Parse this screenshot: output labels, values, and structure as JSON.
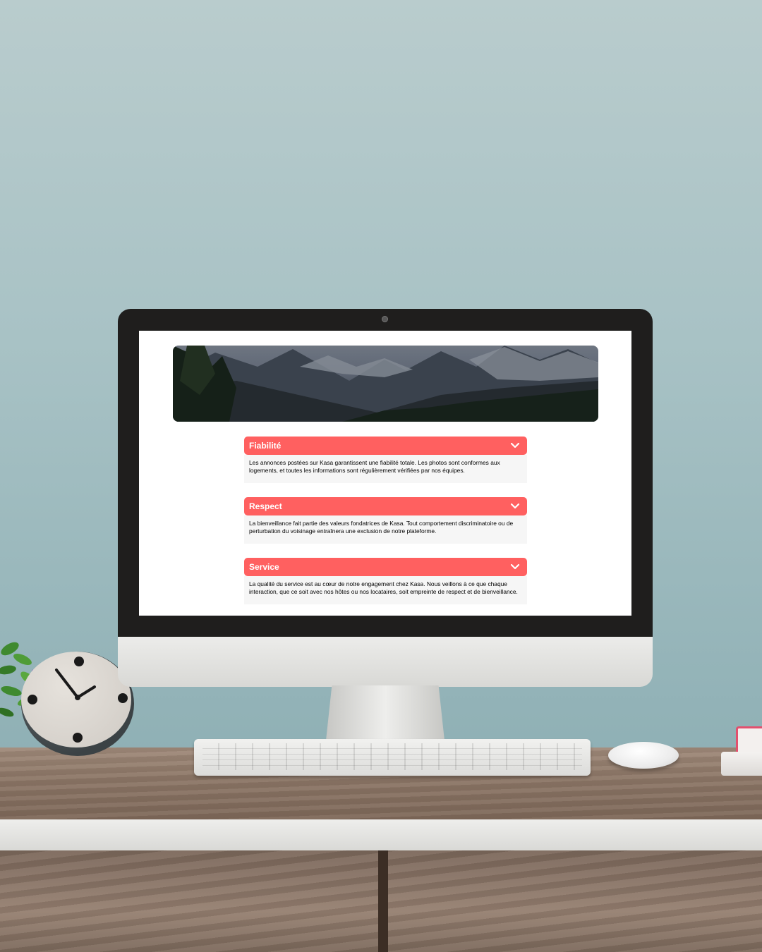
{
  "website": {
    "collapses": [
      {
        "title": "Fiabilité",
        "text": "Les annonces postées sur Kasa garantissent une fiabilité totale. Les photos sont conformes aux logements, et toutes les informations sont régulièrement vérifiées par nos équipes."
      },
      {
        "title": "Respect",
        "text": "La bienveillance fait partie des valeurs fondatrices de Kasa. Tout comportement discriminatoire ou de perturbation du voisinage entraînera une exclusion de notre plateforme."
      },
      {
        "title": "Service",
        "text": "La qualité du service est au cœur de notre engagement chez Kasa. Nous veillons à ce que chaque interaction, que ce soit avec nos hôtes ou nos locataires, soit empreinte de respect et de bienveillance."
      }
    ],
    "icons": {
      "collapse_toggle": "chevron-down-icon"
    },
    "colors": {
      "accent": "#ff6060",
      "body_background": "#f6f6f6",
      "page_background": "#ffffff"
    }
  }
}
